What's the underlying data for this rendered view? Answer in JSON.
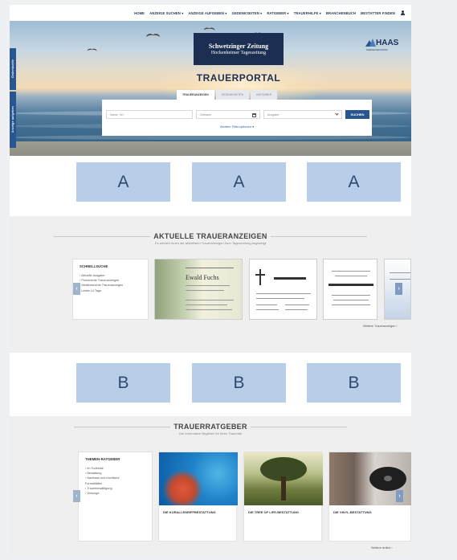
{
  "nav": {
    "items": [
      "Home",
      "Anzeige suchen ▾",
      "Anzeige aufgeben ▾",
      "Gedenkseiten ▾",
      "Ratgeber ▾",
      "Trauerhilfe ▾",
      "Branchenbuch",
      "Bestatter finden"
    ]
  },
  "side_tabs": [
    "Gedenkseite",
    "Anzeige aufgeben"
  ],
  "hero": {
    "logo_line1": "Schwetzinger Zeitung",
    "logo_line2": "Hockenheimer Tageszeitung",
    "portal_title": "TRAUERPORTAL",
    "partner_logo": "HAAS",
    "partner_sub": "MEDIENGRUPPE"
  },
  "search": {
    "tabs": [
      "Traueranzeigen",
      "Gedenkseiten",
      "Ratgeber"
    ],
    "name_placeholder": "Name, Ort",
    "date_placeholder": "Zeitraum",
    "edition_placeholder": "Ausgabe",
    "button_label": "SUCHEN",
    "more_options": "Weitere Filteroptionen ▾"
  },
  "ads_row1": [
    "A",
    "A",
    "A"
  ],
  "ads_row2": [
    "B",
    "B",
    "B"
  ],
  "notices_section": {
    "title": "AKTUELLE TRAUERANZEIGEN",
    "subtitle": "Es werden Ihnen die aktuellsten Traueranzeigen Ihrer Tageszeitung angezeigt",
    "quicklinks_title": "SCHNELLSUCHE",
    "quicklinks": [
      "› Aktuelle Ausgabe",
      "› Prominente Traueranzeigen",
      "› Meistbesuchte Traueranzeigen",
      "› Letzte 14 Tage"
    ],
    "notice_name": "Ewald Fuchs",
    "more_link": "Weitere Traueranzeigen ›"
  },
  "guide_section": {
    "title": "TRAUERRATGEBER",
    "subtitle": "Der informative Begleiter für Ihren Trauerfall",
    "topics_title": "THEMEN-RATGEBER",
    "topics": [
      "› Im Todesfall",
      "› Bestattung",
      "› Nachlass und rechtliche",
      "   Formalitäten",
      "› Trauerbewältigung",
      "› Vorsorge"
    ],
    "cards": [
      "DIE KORALLENRIFFBESTATTUNG",
      "DIE TREE OF LIFE-BESTATTUNG",
      "DIE VINYL-BESTATTUNG"
    ],
    "more_link": "Weitere Artikel ›"
  },
  "colors": {
    "nav_text": "#2b3a55",
    "accent_blue": "#2a5690",
    "ad_background": "#b7cde8"
  }
}
